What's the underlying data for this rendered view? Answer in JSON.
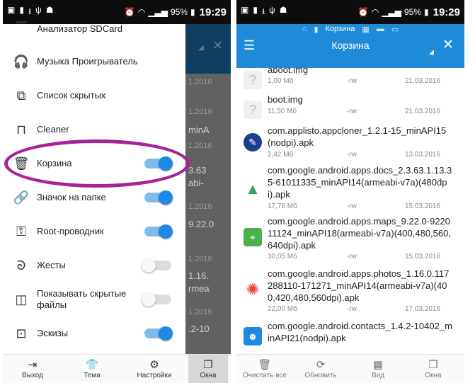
{
  "status": {
    "battery": "95%",
    "time": "19:29"
  },
  "left": {
    "bg": {
      "dates": [
        "1.2016",
        "1.2016",
        "1.2016",
        "1.2016",
        "1.2016",
        "1.2016",
        "1.2016",
        "1.2016",
        "1.2016"
      ],
      "partials": [
        "minA",
        "3.63",
        "abi-",
        "9.22.0",
        "1.16.",
        "rmea",
        ".2-10"
      ]
    },
    "drawer": {
      "items": [
        {
          "label": "Анализатор SDCard",
          "icon": "sdcard-analyzer-icon",
          "toggle": null
        },
        {
          "label": "Музыка Проигрыватель",
          "icon": "headphones-icon",
          "toggle": null
        },
        {
          "label": "Список скрытых",
          "icon": "hidden-list-icon",
          "toggle": null
        },
        {
          "label": "Cleaner",
          "icon": "cleaner-icon",
          "toggle": null
        },
        {
          "label": "Корзина",
          "icon": "trash-icon",
          "toggle": "on"
        },
        {
          "label": "Значок на папке",
          "icon": "link-icon",
          "toggle": "on"
        },
        {
          "label": "Root-проводник",
          "icon": "root-icon",
          "toggle": "on"
        },
        {
          "label": "Жесты",
          "icon": "gesture-icon",
          "toggle": "off"
        },
        {
          "label": "Показывать скрытые\nфайлы",
          "icon": "show-hidden-icon",
          "toggle": "off"
        },
        {
          "label": "Эскизы",
          "icon": "thumbnails-icon",
          "toggle": "on"
        }
      ]
    },
    "bottom": {
      "exit": "Выход",
      "theme": "Тема",
      "settings": "Настройки",
      "windows": "Окна"
    }
  },
  "right": {
    "path": "Корзина",
    "title": "Корзина",
    "files": [
      {
        "name": "aboot.img",
        "size": "1,00 Мб",
        "perm": "-rw",
        "date": "21.03.2016",
        "icon": "generic"
      },
      {
        "name": "boot.img",
        "size": "11,50 Мб",
        "perm": "-rw",
        "date": "21.03.2016",
        "icon": "generic"
      },
      {
        "name": "com.applisto.appcloner_1.2.1-15_minAPI15(nodpi).apk",
        "size": "2,42 Мб",
        "perm": "-rw",
        "date": "13.03.2016",
        "icon": "appcloner"
      },
      {
        "name": "com.google.android.apps.docs_2.3.63.1.13.35-61011335_minAPI14(armeabi-v7a)(480dpi).apk",
        "size": "17,76 Мб",
        "perm": "-rw",
        "date": "15.03.2016",
        "icon": "drive"
      },
      {
        "name": "com.google.android.apps.maps_9.22.0-922011124_minAPI18(armeabi-v7a)(400,480,560,640dpi).apk",
        "size": "30,05 Мб",
        "perm": "-rw",
        "date": "15.03.2016",
        "icon": "maps"
      },
      {
        "name": "com.google.android.apps.photos_1.16.0.117288110-171271_minAPI14(armeabi-v7a)(400,420,480,560dpi).apk",
        "size": "22,00 Мб",
        "perm": "-rw",
        "date": "17.03.2016",
        "icon": "photos"
      },
      {
        "name": "com.google.android.contacts_1.4.2-10402_minAPI21(nodpi).apk",
        "size": "",
        "perm": "",
        "date": "",
        "icon": "contacts"
      }
    ],
    "bottom": {
      "clear": "Очистить все",
      "refresh": "Обновить",
      "view": "Вид",
      "windows": "Окна"
    }
  }
}
